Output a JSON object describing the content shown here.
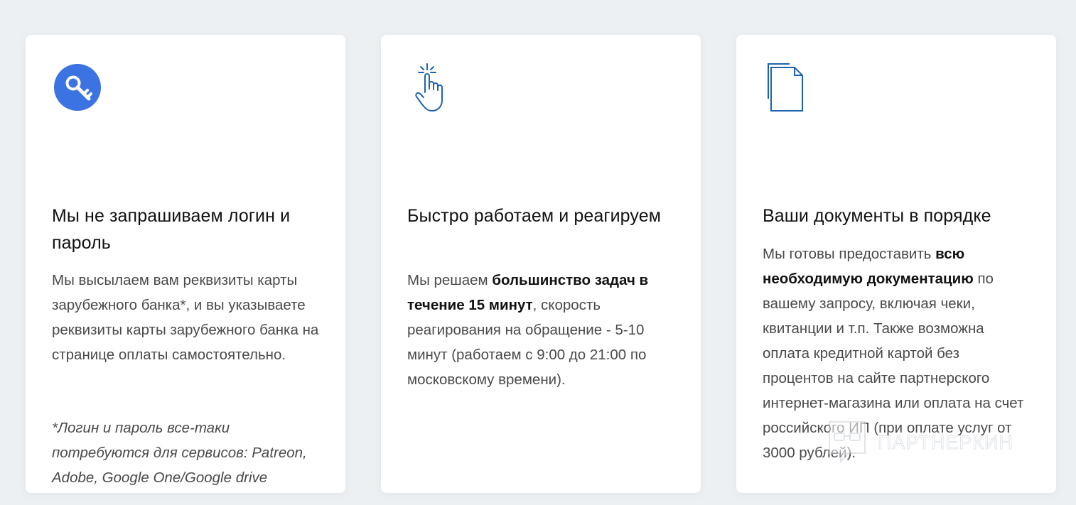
{
  "cards": [
    {
      "icon": "key-icon",
      "title": "Мы не запрашиваем логин и пароль",
      "text": "Мы высылаем вам реквизиты карты зарубежного банка*, и вы указываете реквизиты карты зарубежного банка на странице оплаты самостоятельно.",
      "note": "*Логин и пароль все-таки потребуются для сервисов: Patreon, Adobe, Google One/Google drive"
    },
    {
      "icon": "tap-hand-icon",
      "title": "Быстро работаем и реагируем",
      "text_parts": {
        "before": "Мы решаем ",
        "bold": "большинство задач в течение 15 минут",
        "after": ", скорость реагирования на обращение - 5-10 минут (работаем с 9:00 до 21:00 по московскому времени)."
      }
    },
    {
      "icon": "documents-icon",
      "title": "Ваши документы в порядке",
      "text_parts": {
        "before": "Мы готовы предоставить ",
        "bold": "всю необходимую документацию",
        "after": " по вашему запросу, включая чеки, квитанции и т.п. Также возможна оплата кредитной картой без процентов на сайте партнерского интернет-магазина или оплата на счет российского ИП (при оплате услуг от 3000 рублей)."
      }
    }
  ],
  "watermark": {
    "text": "ПАРТНЕРКИН",
    "icon": "glasses-chat-logo-icon"
  },
  "colors": {
    "background": "#edf0f3",
    "card": "#ffffff",
    "key_circle": "#3b73e2",
    "line_icon": "#1f63b0"
  }
}
